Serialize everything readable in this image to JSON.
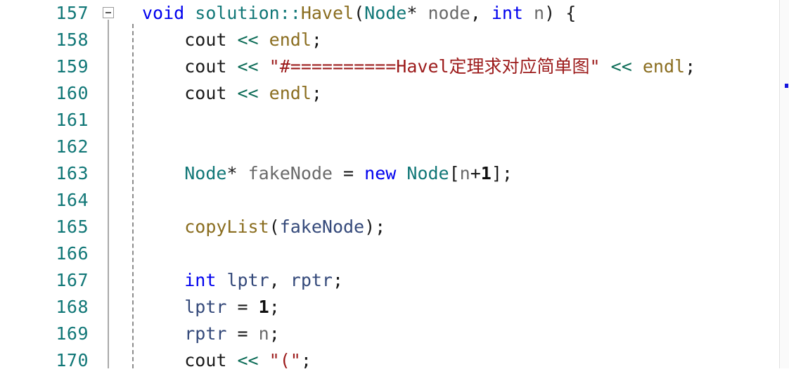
{
  "editor": {
    "language": "cpp",
    "theme": "light",
    "colors": {
      "background": "#ffffff",
      "line_number": "#117777",
      "keyword": "#0000ee",
      "type": "#117777",
      "function": "#8a6d1f",
      "variable": "#6a6a6a",
      "local_variable": "#34497a",
      "operator": "#0b6b56",
      "string": "#9c1b1b",
      "punctuation": "#1a1a1a",
      "fold_guide": "#a9a9a9",
      "indent_guide": "#8d8d8d",
      "scroll_marker": "#1515dd"
    },
    "fold_marker": {
      "line": "157",
      "state": "expanded",
      "glyph": "minus-box"
    },
    "scrollbar": {
      "marker_label": "change-marker"
    },
    "line_numbers": [
      "157",
      "158",
      "159",
      "160",
      "161",
      "162",
      "163",
      "164",
      "165",
      "166",
      "167",
      "168",
      "169",
      "170"
    ],
    "lines": [
      {
        "number": "157",
        "tokens": [
          {
            "t": "void",
            "c": "kw"
          },
          {
            "t": " ",
            "c": "plain"
          },
          {
            "t": "solution",
            "c": "type"
          },
          {
            "t": "::",
            "c": "type"
          },
          {
            "t": "Havel",
            "c": "fn"
          },
          {
            "t": "(",
            "c": "punc"
          },
          {
            "t": "Node",
            "c": "type"
          },
          {
            "t": "*",
            "c": "punc"
          },
          {
            "t": " ",
            "c": "plain"
          },
          {
            "t": "node",
            "c": "var"
          },
          {
            "t": ", ",
            "c": "punc"
          },
          {
            "t": "int",
            "c": "kw"
          },
          {
            "t": " ",
            "c": "plain"
          },
          {
            "t": "n",
            "c": "var"
          },
          {
            "t": ") {",
            "c": "punc"
          }
        ]
      },
      {
        "number": "158",
        "tokens": [
          {
            "t": "    ",
            "c": "plain"
          },
          {
            "t": "cout",
            "c": "punc"
          },
          {
            "t": " ",
            "c": "plain"
          },
          {
            "t": "<<",
            "c": "op"
          },
          {
            "t": " ",
            "c": "plain"
          },
          {
            "t": "endl",
            "c": "fn"
          },
          {
            "t": ";",
            "c": "punc"
          }
        ]
      },
      {
        "number": "159",
        "tokens": [
          {
            "t": "    ",
            "c": "plain"
          },
          {
            "t": "cout",
            "c": "punc"
          },
          {
            "t": " ",
            "c": "plain"
          },
          {
            "t": "<<",
            "c": "op"
          },
          {
            "t": " ",
            "c": "plain"
          },
          {
            "t": "\"#==========Havel定理求对应简单图\"",
            "c": "str"
          },
          {
            "t": " ",
            "c": "plain"
          },
          {
            "t": "<<",
            "c": "op"
          },
          {
            "t": " ",
            "c": "plain"
          },
          {
            "t": "endl",
            "c": "fn"
          },
          {
            "t": ";",
            "c": "punc"
          }
        ]
      },
      {
        "number": "160",
        "tokens": [
          {
            "t": "    ",
            "c": "plain"
          },
          {
            "t": "cout",
            "c": "punc"
          },
          {
            "t": " ",
            "c": "plain"
          },
          {
            "t": "<<",
            "c": "op"
          },
          {
            "t": " ",
            "c": "plain"
          },
          {
            "t": "endl",
            "c": "fn"
          },
          {
            "t": ";",
            "c": "punc"
          }
        ]
      },
      {
        "number": "161",
        "tokens": []
      },
      {
        "number": "162",
        "tokens": []
      },
      {
        "number": "163",
        "tokens": [
          {
            "t": "    ",
            "c": "plain"
          },
          {
            "t": "Node",
            "c": "type"
          },
          {
            "t": "*",
            "c": "punc"
          },
          {
            "t": " ",
            "c": "plain"
          },
          {
            "t": "fakeNode",
            "c": "var"
          },
          {
            "t": " ",
            "c": "plain"
          },
          {
            "t": "=",
            "c": "punc"
          },
          {
            "t": " ",
            "c": "plain"
          },
          {
            "t": "new",
            "c": "kw"
          },
          {
            "t": " ",
            "c": "plain"
          },
          {
            "t": "Node",
            "c": "type"
          },
          {
            "t": "[",
            "c": "punc"
          },
          {
            "t": "n",
            "c": "var"
          },
          {
            "t": "+",
            "c": "punc"
          },
          {
            "t": "1",
            "c": "num"
          },
          {
            "t": "];",
            "c": "punc"
          }
        ]
      },
      {
        "number": "164",
        "tokens": []
      },
      {
        "number": "165",
        "tokens": [
          {
            "t": "    ",
            "c": "plain"
          },
          {
            "t": "copyList",
            "c": "fn"
          },
          {
            "t": "(",
            "c": "punc"
          },
          {
            "t": "fakeNode",
            "c": "localv"
          },
          {
            "t": ");",
            "c": "punc"
          }
        ]
      },
      {
        "number": "166",
        "tokens": []
      },
      {
        "number": "167",
        "tokens": [
          {
            "t": "    ",
            "c": "plain"
          },
          {
            "t": "int",
            "c": "kw"
          },
          {
            "t": " ",
            "c": "plain"
          },
          {
            "t": "lptr",
            "c": "localv"
          },
          {
            "t": ", ",
            "c": "punc"
          },
          {
            "t": "rptr",
            "c": "localv"
          },
          {
            "t": ";",
            "c": "punc"
          }
        ]
      },
      {
        "number": "168",
        "tokens": [
          {
            "t": "    ",
            "c": "plain"
          },
          {
            "t": "lptr",
            "c": "localv"
          },
          {
            "t": " ",
            "c": "plain"
          },
          {
            "t": "=",
            "c": "punc"
          },
          {
            "t": " ",
            "c": "plain"
          },
          {
            "t": "1",
            "c": "num"
          },
          {
            "t": ";",
            "c": "punc"
          }
        ]
      },
      {
        "number": "169",
        "tokens": [
          {
            "t": "    ",
            "c": "plain"
          },
          {
            "t": "rptr",
            "c": "localv"
          },
          {
            "t": " ",
            "c": "plain"
          },
          {
            "t": "=",
            "c": "punc"
          },
          {
            "t": " ",
            "c": "plain"
          },
          {
            "t": "n",
            "c": "var"
          },
          {
            "t": ";",
            "c": "punc"
          }
        ]
      },
      {
        "number": "170",
        "tokens": [
          {
            "t": "    ",
            "c": "plain"
          },
          {
            "t": "cout",
            "c": "punc"
          },
          {
            "t": " ",
            "c": "plain"
          },
          {
            "t": "<<",
            "c": "op"
          },
          {
            "t": " ",
            "c": "plain"
          },
          {
            "t": "\"(\"",
            "c": "str"
          },
          {
            "t": ";",
            "c": "punc"
          }
        ]
      }
    ]
  }
}
